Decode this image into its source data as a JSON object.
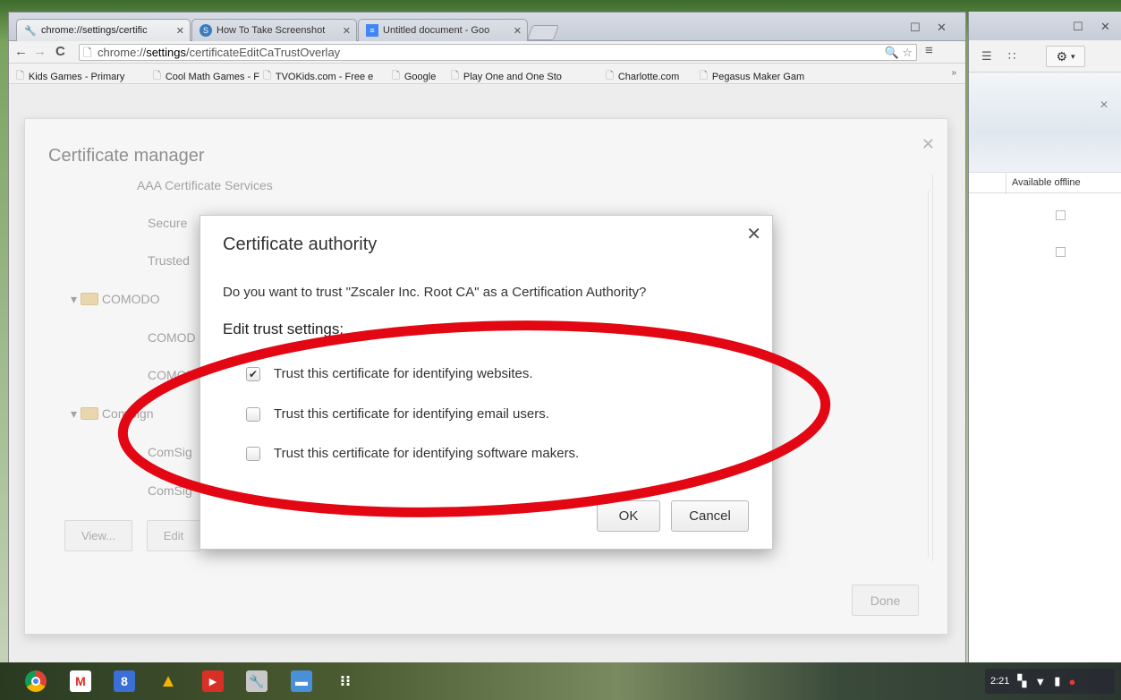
{
  "browser": {
    "tabs": [
      {
        "title": "chrome://settings/certific",
        "icon": "wrench-icon",
        "active": true
      },
      {
        "title": "How To Take Screenshot",
        "icon": "site-favicon",
        "active": false
      },
      {
        "title": "Untitled document - Goo",
        "icon": "docs-icon",
        "active": false
      }
    ],
    "address": {
      "prefix": "chrome://",
      "bold": "settings",
      "suffix": "/certificateEditCaTrustOverlay"
    },
    "bookmarks": [
      "Kids Games - Primary",
      "Cool Math Games - F",
      "TVOKids.com - Free e",
      "Google",
      "Play One and One Sto",
      "Charlotte.com",
      "Pegasus Maker Gam"
    ],
    "bookmarks_more": "»"
  },
  "cert_manager": {
    "title": "Certificate manager",
    "rows": [
      {
        "text": "AAA Certificate Services",
        "indent": 2
      },
      {
        "text": "Secure",
        "indent": 2
      },
      {
        "text": "Trusted",
        "indent": 2
      },
      {
        "text": "COMODO",
        "indent": 1,
        "folder": true
      },
      {
        "text": "COMOD",
        "indent": 2
      },
      {
        "text": "COMOD",
        "indent": 2
      },
      {
        "text": "ComSign",
        "indent": 1,
        "folder": true
      },
      {
        "text": "ComSig",
        "indent": 2
      },
      {
        "text": "ComSig",
        "indent": 2
      }
    ],
    "buttons": {
      "view": "View...",
      "edit": "Edit"
    },
    "done_label": "Done"
  },
  "dialog": {
    "title": "Certificate authority",
    "question": "Do you want to trust \"Zscaler Inc. Root CA\" as a Certification Authority?",
    "section": "Edit trust settings:",
    "options": [
      {
        "label": "Trust this certificate for identifying websites.",
        "checked": true
      },
      {
        "label": "Trust this certificate for identifying email users.",
        "checked": false
      },
      {
        "label": "Trust this certificate for identifying software makers.",
        "checked": false
      }
    ],
    "ok_label": "OK",
    "cancel_label": "Cancel",
    "annotation_color": "#e30613"
  },
  "side_window": {
    "column_header": "Available offline"
  },
  "taskbar": {
    "apps": [
      "chrome-icon",
      "gmail-icon",
      "google-plus-icon",
      "drive-icon",
      "youtube-icon",
      "settings-icon",
      "files-icon",
      "app-launcher-icon"
    ],
    "time": "2:21"
  }
}
